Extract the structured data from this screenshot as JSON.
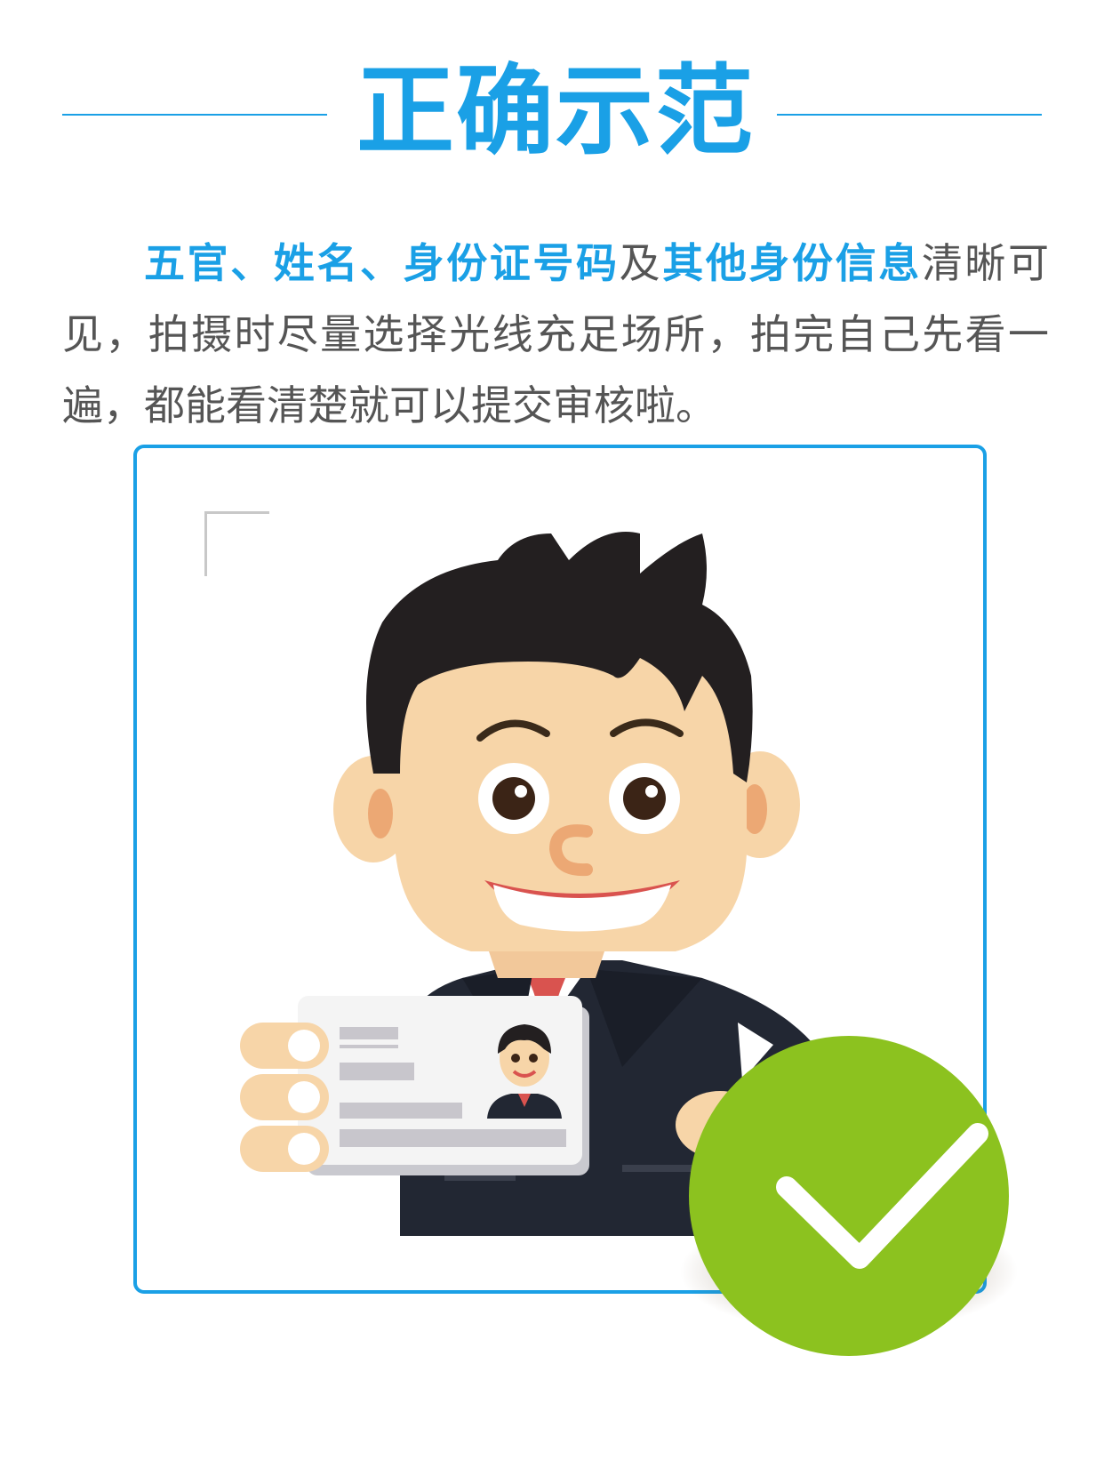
{
  "header": {
    "title": "正确示范"
  },
  "description": {
    "highlight_1": "五官、姓名、身份证号码",
    "text_1": "及",
    "highlight_2": "其他身份信息",
    "text_2": "清晰可见，拍摄时尽量选择光线充足场所，拍完自己先看一遍，都能看清楚就可以提交审核啦。"
  },
  "icons": {
    "illustration": "man-holding-id-card-illustration",
    "status": "check-icon"
  },
  "colors": {
    "accent": "#1aa0e6",
    "text": "#555555",
    "success": "#8cc21f"
  }
}
